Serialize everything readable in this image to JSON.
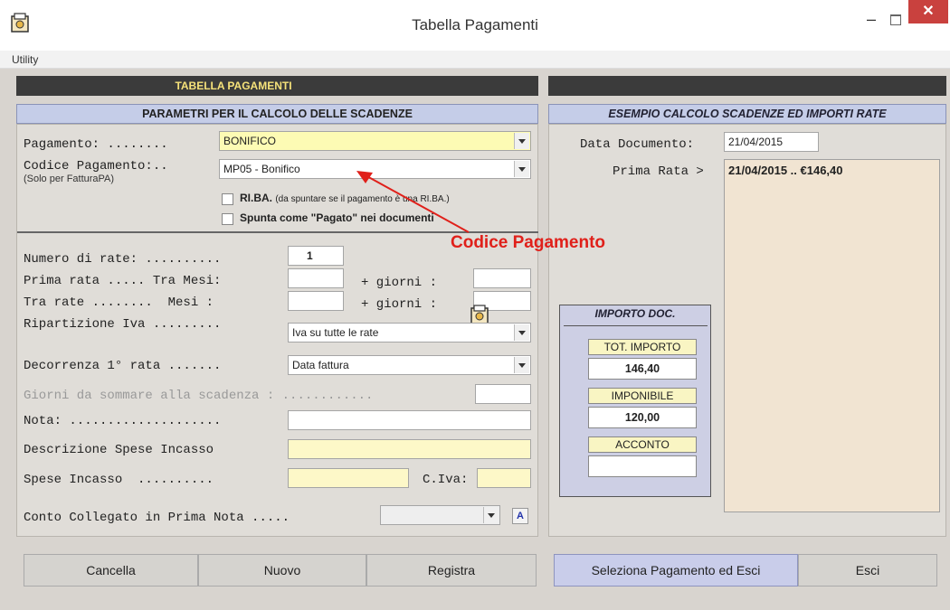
{
  "window": {
    "title": "Tabella Pagamenti",
    "min": "–",
    "close": "✕"
  },
  "menu": {
    "utility": "Utility"
  },
  "left_header": "TABELLA  PAGAMENTI",
  "left_section": "PARAMETRI PER IL CALCOLO DELLE SCADENZE",
  "right_section": "ESEMPIO CALCOLO SCADENZE ED IMPORTI RATE",
  "form": {
    "pagamento_label": "Pagamento: ........",
    "pagamento_value": "BONIFICO",
    "codice_label": "Codice Pagamento:..",
    "codice_sub": "(Solo per FatturaPA)",
    "codice_value": "MP05 - Bonifico",
    "riba_bold": "RI.BA.",
    "riba_note": "(da spuntare se il pagamento è una RI.BA.)",
    "spunta_label": "Spunta come \"Pagato\" nei documenti",
    "num_rate_label": "Numero di rate: ..........",
    "num_rate_value": "1",
    "prima_rata_label": "Prima rata ..... Tra Mesi:",
    "giorni_label_1": "+ giorni :",
    "tra_rate_label": "Tra rate ........  Mesi :",
    "giorni_label_2": "+ giorni :",
    "ripartizione_label": "Ripartizione Iva .........",
    "ripartizione_value": "Iva su tutte le rate",
    "decorrenza_label": "Decorrenza 1° rata .......",
    "decorrenza_value": "Data fattura",
    "giorni_sommare_label": "Giorni da sommare alla scadenza : ............",
    "nota_label": "Nota: ....................",
    "desc_spese_label": "Descrizione Spese Incasso",
    "spese_label": "Spese Incasso  ..........",
    "civa_label": "C.Iva:",
    "conto_label": "Conto Collegato in Prima Nota .....",
    "conto_a": "A"
  },
  "annotation": "Codice Pagamento",
  "right": {
    "data_doc_label": "Data Documento:",
    "data_doc_value": "21/04/2015",
    "prima_rata_label": "Prima Rata >",
    "prima_rata_value": "21/04/2015 .. €146,40",
    "importo_head": "IMPORTO DOC.",
    "tot_label": "TOT. IMPORTO",
    "tot_value": "146,40",
    "imponibile_label": "IMPONIBILE",
    "imponibile_value": "120,00",
    "acconto_label": "ACCONTO",
    "acconto_value": ""
  },
  "buttons": {
    "cancella": "Cancella",
    "nuovo": "Nuovo",
    "registra": "Registra",
    "seleziona": "Seleziona Pagamento ed Esci",
    "esci": "Esci"
  },
  "colors": {
    "accent_yellow": "#fdfbb4",
    "header_blue": "#c5cde8",
    "annotation_red": "#e0201a",
    "close_red": "#c9413e"
  }
}
